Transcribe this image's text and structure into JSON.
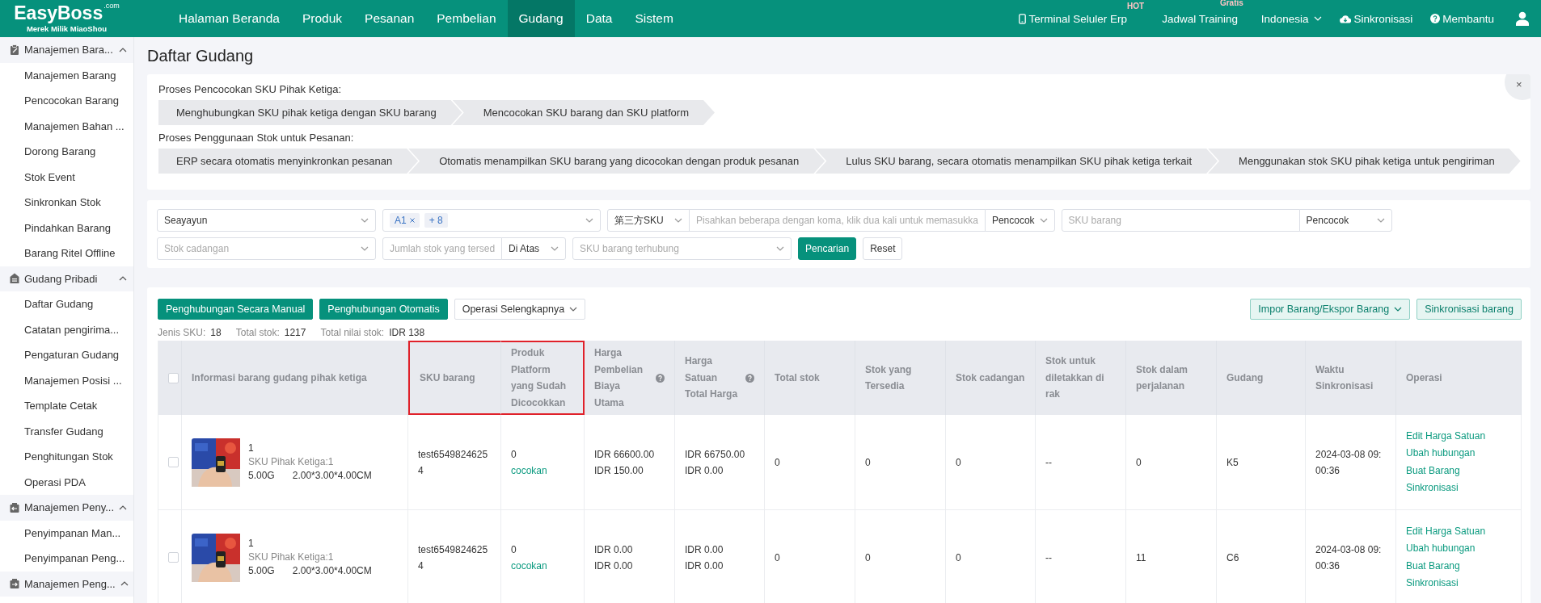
{
  "logo": {
    "name": "EasyBoss",
    "suffix": ".com",
    "tagline": "Merek Milik MiaoShou"
  },
  "nav": [
    {
      "label": "Halaman Beranda",
      "selected": false
    },
    {
      "label": "Produk",
      "selected": false
    },
    {
      "label": "Pesanan",
      "selected": false
    },
    {
      "label": "Pembelian",
      "selected": false
    },
    {
      "label": "Gudang",
      "selected": true
    },
    {
      "label": "Data",
      "selected": false
    },
    {
      "label": "Sistem",
      "selected": false
    }
  ],
  "top_links": [
    {
      "kind": "device",
      "label": "Terminal Seluler Erp",
      "badge": "HOT"
    },
    {
      "kind": "training",
      "label": "Jadwal Training",
      "badge": "Gratis"
    },
    {
      "kind": "language",
      "label": "Indonesia"
    },
    {
      "kind": "sync",
      "label": "Sinkronisasi"
    },
    {
      "kind": "help",
      "label": "Membantu"
    },
    {
      "kind": "account"
    }
  ],
  "sidebar": [
    {
      "title": "Manajemen Bara...",
      "expanded": true,
      "items": [
        "Manajemen Barang",
        "Pencocokan Barang",
        "Manajemen Bahan ...",
        "Dorong Barang",
        "Stok Event",
        "Sinkronkan Stok",
        "Pindahkan Barang",
        "Barang Ritel Offline"
      ]
    },
    {
      "title": "Gudang Pribadi",
      "expanded": true,
      "items": [
        "Daftar Gudang",
        "Catatan pengirima...",
        "Pengaturan Gudang",
        "Manajemen Posisi ...",
        "Template Cetak",
        "Transfer Gudang",
        "Penghitungan Stok",
        "Operasi PDA"
      ]
    },
    {
      "title": "Manajemen Peny...",
      "expanded": true,
      "items": [
        "Penyimpanan Man...",
        "Penyimpanan Peng..."
      ]
    },
    {
      "title": "Manajemen Peng...",
      "expanded": true
    }
  ],
  "page_title": "Daftar Gudang",
  "process": {
    "close": "×",
    "groups": [
      {
        "title": "Proses Pencocokan SKU Pihak Ketiga:",
        "steps": [
          "Menghubungkan SKU pihak ketiga dengan SKU barang",
          "Mencocokan SKU barang dan SKU platform"
        ]
      },
      {
        "title": "Proses Penggunaan Stok untuk Pesanan:",
        "steps": [
          "ERP secara otomatis menyinkronkan pesanan",
          "Otomatis menampilkan SKU barang yang dicocokan dengan produk pesanan",
          "Lulus SKU barang, secara otomatis menampilkan SKU pihak ketiga terkait",
          "Menggunakan stok SKU pihak ketiga untuk pengiriman"
        ]
      }
    ]
  },
  "filter_rows": [
    [
      [
        {
          "kind": "select",
          "value": "Seayayun"
        }
      ],
      [
        {
          "kind": "tags",
          "tags": [
            "A1"
          ],
          "more": "+ 8"
        }
      ],
      [
        {
          "kind": "select",
          "value": "第三方SKU"
        },
        {
          "kind": "input",
          "placeholder": "Pisahkan beberapa dengan koma, klik dua kali untuk memasukka"
        },
        {
          "kind": "select",
          "value": "Pencocok"
        }
      ],
      [
        {
          "kind": "input",
          "placeholder": "SKU barang"
        },
        {
          "kind": "select",
          "value": "Pencocok"
        }
      ]
    ],
    [
      [
        {
          "kind": "select",
          "placeholder": "Stok cadangan"
        }
      ],
      [
        {
          "kind": "input",
          "placeholder": "Jumlah stok yang tersed"
        },
        {
          "kind": "select",
          "value": "Di Atas"
        }
      ],
      [
        {
          "kind": "select",
          "placeholder": "SKU barang terhubung"
        }
      ],
      [
        {
          "kind": "primary",
          "label": "Pencarian"
        }
      ],
      [
        {
          "kind": "plain",
          "label": "Reset"
        }
      ]
    ]
  ],
  "toolbar": {
    "left": [
      {
        "kind": "primary",
        "label": "Penghubungan Secara Manual"
      },
      {
        "kind": "primary",
        "label": "Penghubungan Otomatis"
      },
      {
        "kind": "dropdown",
        "label": "Operasi Selengkapnya"
      }
    ],
    "right": [
      {
        "kind": "dropdown-light",
        "label": "Impor Barang/Ekspor Barang"
      },
      {
        "kind": "light",
        "label": "Sinkronisasi barang"
      }
    ]
  },
  "stats": [
    {
      "label": "Jenis SKU:",
      "value": "18"
    },
    {
      "label": "Total stok:",
      "value": "1217"
    },
    {
      "label": "Total nilai stok:",
      "value": "IDR 138"
    }
  ],
  "table": {
    "all_checked": false,
    "columns": [
      {
        "label": "Informasi barang gudang pihak ketiga",
        "help": false,
        "highlighted": false
      },
      {
        "label": "SKU barang",
        "help": false,
        "highlighted": true
      },
      {
        "label": "Produk Platform yang Sudah Dicocokkan",
        "help": false,
        "highlighted": true
      },
      {
        "label": "Harga Pembelian Biaya Utama",
        "help": true,
        "highlighted": false
      },
      {
        "label": "Harga Satuan Total Harga",
        "help": true,
        "highlighted": false
      },
      {
        "label": "Total stok",
        "help": false,
        "highlighted": false
      },
      {
        "label": "Stok yang Tersedia",
        "help": false,
        "highlighted": false
      },
      {
        "label": "Stok cadangan",
        "help": false,
        "highlighted": false
      },
      {
        "label": "Stok untuk diletakkan di rak",
        "help": false,
        "highlighted": false
      },
      {
        "label": "Stok dalam perjalanan",
        "help": false,
        "highlighted": false
      },
      {
        "label": "Gudang",
        "help": false,
        "highlighted": false
      },
      {
        "label": "Waktu Sinkronisasi",
        "help": false,
        "highlighted": false
      },
      {
        "label": "Operasi",
        "help": false,
        "highlighted": false
      }
    ],
    "rows": [
      {
        "checked": false,
        "thumbnail": {
          "kind": "picture"
        },
        "title": "1",
        "third_party_sku": "SKU Pihak Ketiga:1",
        "weight": "5.00G",
        "size": "2.00*3.00*4.00CM",
        "sku": "test65498246254",
        "matched_count": "0",
        "matched_link": "cocokan",
        "purchase": [
          "IDR 66600.00",
          "IDR 150.00"
        ],
        "unit": [
          "IDR 66750.00",
          "IDR 0.00"
        ],
        "total": "0",
        "available": "0",
        "reserved": "0",
        "shelf": "--",
        "transit": "0",
        "warehouse": "K5",
        "time": "2024-03-08 09:00:36",
        "operations": [
          "Edit Harga Satuan",
          "Ubah hubungan",
          "Buat Barang",
          "Sinkronisasi"
        ]
      },
      {
        "checked": false,
        "thumbnail": {
          "kind": "picture"
        },
        "title": "1",
        "third_party_sku": "SKU Pihak Ketiga:1",
        "weight": "5.00G",
        "size": "2.00*3.00*4.00CM",
        "sku": "test65498246254",
        "matched_count": "0",
        "matched_link": "cocokan",
        "purchase": [
          "IDR 0.00",
          "IDR 0.00"
        ],
        "unit": [
          "IDR 0.00",
          "IDR 0.00"
        ],
        "total": "0",
        "available": "0",
        "reserved": "0",
        "shelf": "--",
        "transit": "11",
        "warehouse": "C6",
        "time": "2024-03-08 09:00:36",
        "operations": [
          "Edit Harga Satuan",
          "Ubah hubungan",
          "Buat Barang",
          "Sinkronisasi"
        ]
      }
    ]
  }
}
